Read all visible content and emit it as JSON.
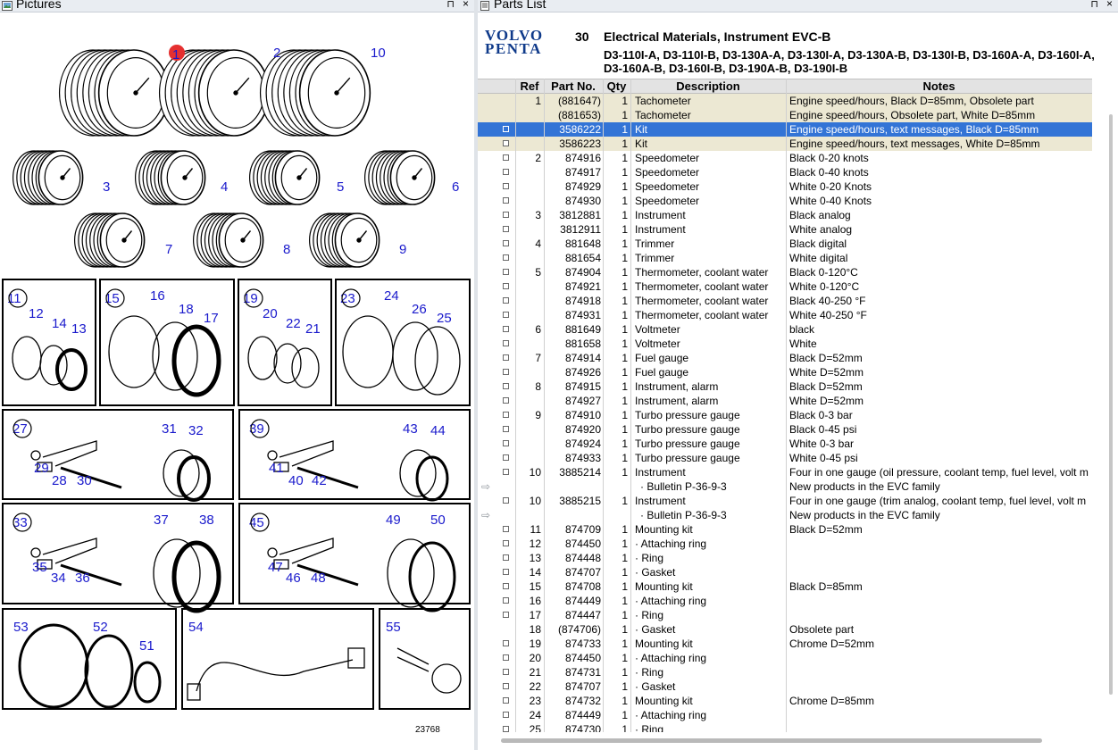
{
  "pictures_pane": {
    "title": "Pictures",
    "pin": "⊓",
    "close": "×",
    "figure_number": "23768",
    "callouts": [
      "1",
      "2",
      "10",
      "3",
      "4",
      "5",
      "6",
      "7",
      "8",
      "9",
      "11",
      "12",
      "14",
      "13",
      "15",
      "16",
      "18",
      "17",
      "19",
      "20",
      "22",
      "21",
      "23",
      "24",
      "26",
      "25",
      "27",
      "29",
      "28",
      "30",
      "31",
      "32",
      "39",
      "41",
      "40",
      "42",
      "43",
      "44",
      "33",
      "35",
      "34",
      "36",
      "37",
      "38",
      "45",
      "47",
      "46",
      "48",
      "49",
      "50",
      "53",
      "52",
      "51",
      "54",
      "55"
    ]
  },
  "parts_pane": {
    "title": "Parts List",
    "pin": "⊓",
    "close": "×",
    "brand_line1": "VOLVO",
    "brand_line2": "PENTA",
    "group_number": "30",
    "group_title": "Electrical Materials, Instrument EVC-B",
    "group_models": "D3-110I-A, D3-110I-B, D3-130A-A, D3-130I-A, D3-130A-B, D3-130I-B, D3-160A-A, D3-160I-A, D3-160A-B, D3-160I-B, D3-190A-B, D3-190I-B",
    "columns": {
      "ref": "Ref",
      "part_no": "Part No.",
      "qty": "Qty",
      "description": "Description",
      "notes": "Notes"
    },
    "rows": [
      {
        "mk": "",
        "ref": "1",
        "pn": "(881647)",
        "qty": "1",
        "desc": "Tachometer",
        "notes": "Engine speed/hours, Black D=85mm, Obsolete part",
        "style": "tan"
      },
      {
        "mk": "",
        "ref": "",
        "pn": "(881653)",
        "qty": "1",
        "desc": "Tachometer",
        "notes": "Engine speed/hours, Obsolete part, White D=85mm",
        "style": "tan"
      },
      {
        "mk": "□",
        "ref": "",
        "pn": "3586222",
        "qty": "1",
        "desc": "Kit",
        "notes": "Engine speed/hours, text messages, Black D=85mm",
        "style": "sel"
      },
      {
        "mk": "□",
        "ref": "",
        "pn": "3586223",
        "qty": "1",
        "desc": "Kit",
        "notes": "Engine speed/hours, text messages, White D=85mm",
        "style": "tan"
      },
      {
        "mk": "□",
        "ref": "2",
        "pn": "874916",
        "qty": "1",
        "desc": "Speedometer",
        "notes": "Black 0-20 knots",
        "style": ""
      },
      {
        "mk": "□",
        "ref": "",
        "pn": "874917",
        "qty": "1",
        "desc": "Speedometer",
        "notes": "Black 0-40 knots",
        "style": ""
      },
      {
        "mk": "□",
        "ref": "",
        "pn": "874929",
        "qty": "1",
        "desc": "Speedometer",
        "notes": "White 0-20 Knots",
        "style": ""
      },
      {
        "mk": "□",
        "ref": "",
        "pn": "874930",
        "qty": "1",
        "desc": "Speedometer",
        "notes": "White 0-40 Knots",
        "style": ""
      },
      {
        "mk": "□",
        "ref": "3",
        "pn": "3812881",
        "qty": "1",
        "desc": "Instrument",
        "notes": "Black analog",
        "style": ""
      },
      {
        "mk": "□",
        "ref": "",
        "pn": "3812911",
        "qty": "1",
        "desc": "Instrument",
        "notes": "White analog",
        "style": ""
      },
      {
        "mk": "□",
        "ref": "4",
        "pn": "881648",
        "qty": "1",
        "desc": "Trimmer",
        "notes": "Black digital",
        "style": ""
      },
      {
        "mk": "□",
        "ref": "",
        "pn": "881654",
        "qty": "1",
        "desc": "Trimmer",
        "notes": "White digital",
        "style": ""
      },
      {
        "mk": "□",
        "ref": "5",
        "pn": "874904",
        "qty": "1",
        "desc": "Thermometer, coolant water",
        "notes": "Black 0-120°C",
        "style": ""
      },
      {
        "mk": "□",
        "ref": "",
        "pn": "874921",
        "qty": "1",
        "desc": "Thermometer, coolant water",
        "notes": "White 0-120°C",
        "style": ""
      },
      {
        "mk": "□",
        "ref": "",
        "pn": "874918",
        "qty": "1",
        "desc": "Thermometer, coolant water",
        "notes": "Black 40-250 °F",
        "style": ""
      },
      {
        "mk": "□",
        "ref": "",
        "pn": "874931",
        "qty": "1",
        "desc": "Thermometer, coolant water",
        "notes": "White 40-250 °F",
        "style": ""
      },
      {
        "mk": "□",
        "ref": "6",
        "pn": "881649",
        "qty": "1",
        "desc": "Voltmeter",
        "notes": "black",
        "style": ""
      },
      {
        "mk": "□",
        "ref": "",
        "pn": "881658",
        "qty": "1",
        "desc": "Voltmeter",
        "notes": "White",
        "style": ""
      },
      {
        "mk": "□",
        "ref": "7",
        "pn": "874914",
        "qty": "1",
        "desc": "Fuel gauge",
        "notes": "Black D=52mm",
        "style": ""
      },
      {
        "mk": "□",
        "ref": "",
        "pn": "874926",
        "qty": "1",
        "desc": "Fuel gauge",
        "notes": "White D=52mm",
        "style": ""
      },
      {
        "mk": "□",
        "ref": "8",
        "pn": "874915",
        "qty": "1",
        "desc": "Instrument, alarm",
        "notes": "Black D=52mm",
        "style": ""
      },
      {
        "mk": "□",
        "ref": "",
        "pn": "874927",
        "qty": "1",
        "desc": "Instrument, alarm",
        "notes": "White D=52mm",
        "style": ""
      },
      {
        "mk": "□",
        "ref": "9",
        "pn": "874910",
        "qty": "1",
        "desc": "Turbo pressure gauge",
        "notes": "Black 0-3 bar",
        "style": ""
      },
      {
        "mk": "□",
        "ref": "",
        "pn": "874920",
        "qty": "1",
        "desc": "Turbo pressure gauge",
        "notes": "Black 0-45 psi",
        "style": ""
      },
      {
        "mk": "□",
        "ref": "",
        "pn": "874924",
        "qty": "1",
        "desc": "Turbo pressure gauge",
        "notes": "White 0-3 bar",
        "style": ""
      },
      {
        "mk": "□",
        "ref": "",
        "pn": "874933",
        "qty": "1",
        "desc": "Turbo pressure gauge",
        "notes": "White 0-45 psi",
        "style": ""
      },
      {
        "mk": "□",
        "ref": "10",
        "pn": "3885214",
        "qty": "1",
        "desc": "Instrument",
        "notes": "Four in one gauge (oil pressure, coolant temp, fuel level, volt m",
        "style": ""
      },
      {
        "mk": "⇨",
        "ref": "",
        "pn": "",
        "qty": "",
        "desc": "· Bulletin P-36-9-3",
        "notes": "New products in the EVC family",
        "style": "sub"
      },
      {
        "mk": "□",
        "ref": "10",
        "pn": "3885215",
        "qty": "1",
        "desc": "Instrument",
        "notes": "Four in one gauge (trim analog, coolant temp, fuel level, volt m",
        "style": ""
      },
      {
        "mk": "⇨",
        "ref": "",
        "pn": "",
        "qty": "",
        "desc": "· Bulletin P-36-9-3",
        "notes": "New products in the EVC family",
        "style": "sub"
      },
      {
        "mk": "□",
        "ref": "11",
        "pn": "874709",
        "qty": "1",
        "desc": "Mounting kit",
        "notes": "Black D=52mm",
        "style": ""
      },
      {
        "mk": "□",
        "ref": "12",
        "pn": "874450",
        "qty": "1",
        "desc": "· Attaching ring",
        "notes": "",
        "style": ""
      },
      {
        "mk": "□",
        "ref": "13",
        "pn": "874448",
        "qty": "1",
        "desc": "· Ring",
        "notes": "",
        "style": ""
      },
      {
        "mk": "□",
        "ref": "14",
        "pn": "874707",
        "qty": "1",
        "desc": "· Gasket",
        "notes": "",
        "style": ""
      },
      {
        "mk": "□",
        "ref": "15",
        "pn": "874708",
        "qty": "1",
        "desc": "Mounting kit",
        "notes": "Black D=85mm",
        "style": ""
      },
      {
        "mk": "□",
        "ref": "16",
        "pn": "874449",
        "qty": "1",
        "desc": "· Attaching ring",
        "notes": "",
        "style": ""
      },
      {
        "mk": "□",
        "ref": "17",
        "pn": "874447",
        "qty": "1",
        "desc": "· Ring",
        "notes": "",
        "style": ""
      },
      {
        "mk": "",
        "ref": "18",
        "pn": "(874706)",
        "qty": "1",
        "desc": "· Gasket",
        "notes": "Obsolete part",
        "style": ""
      },
      {
        "mk": "□",
        "ref": "19",
        "pn": "874733",
        "qty": "1",
        "desc": "Mounting kit",
        "notes": "Chrome D=52mm",
        "style": ""
      },
      {
        "mk": "□",
        "ref": "20",
        "pn": "874450",
        "qty": "1",
        "desc": "· Attaching ring",
        "notes": "",
        "style": ""
      },
      {
        "mk": "□",
        "ref": "21",
        "pn": "874731",
        "qty": "1",
        "desc": "· Ring",
        "notes": "",
        "style": ""
      },
      {
        "mk": "□",
        "ref": "22",
        "pn": "874707",
        "qty": "1",
        "desc": "· Gasket",
        "notes": "",
        "style": ""
      },
      {
        "mk": "□",
        "ref": "23",
        "pn": "874732",
        "qty": "1",
        "desc": "Mounting kit",
        "notes": "Chrome D=85mm",
        "style": ""
      },
      {
        "mk": "□",
        "ref": "24",
        "pn": "874449",
        "qty": "1",
        "desc": "· Attaching ring",
        "notes": "",
        "style": ""
      },
      {
        "mk": "□",
        "ref": "25",
        "pn": "874730",
        "qty": "1",
        "desc": "· Ring",
        "notes": "",
        "style": ""
      }
    ]
  }
}
